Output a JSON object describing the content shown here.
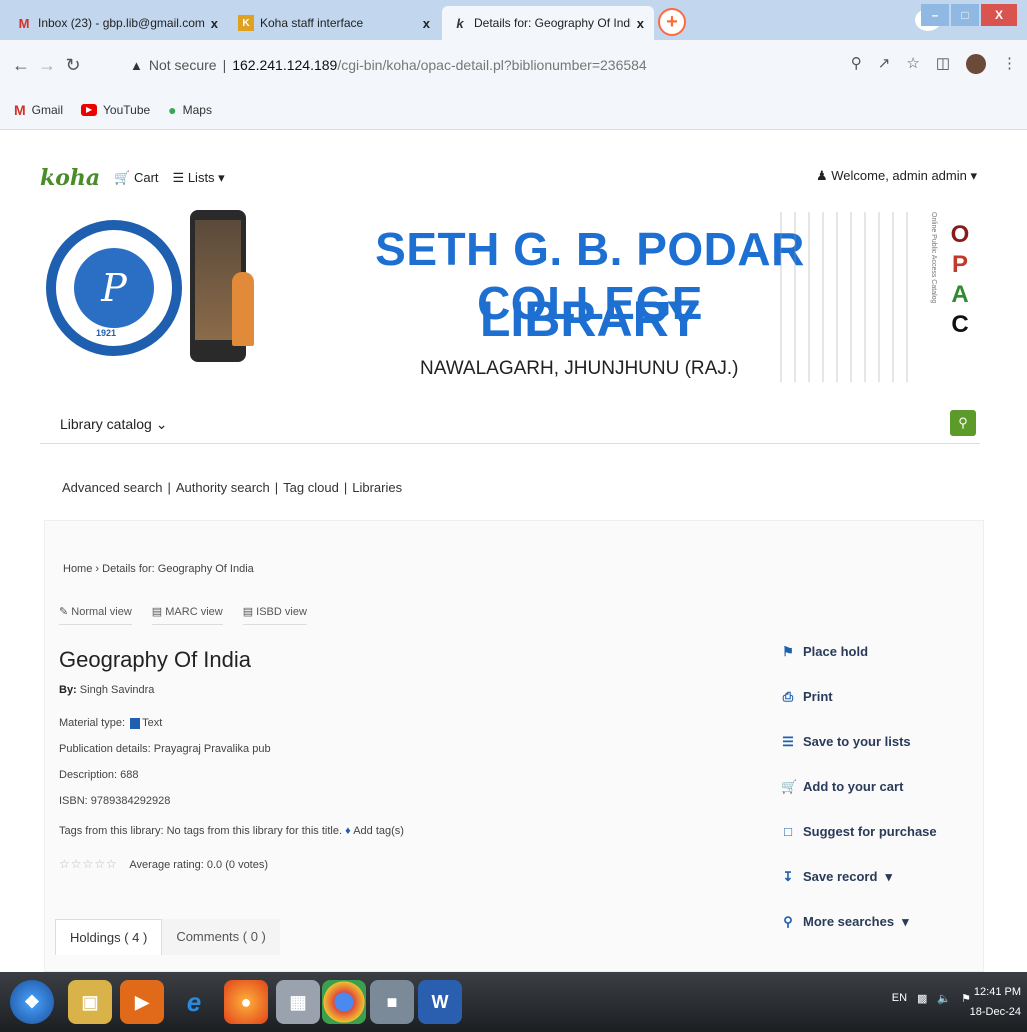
{
  "browser": {
    "tabs": [
      {
        "label": "Inbox (23) - gbp.lib@gmail.com",
        "icon": "gmail-icon"
      },
      {
        "label": "Koha staff interface",
        "icon": "koha-icon"
      },
      {
        "label": "Details for: Geography Of India",
        "icon": "koha-k-icon"
      }
    ],
    "url_security": "Not secure",
    "url_host": "162.241.124.189",
    "url_path": "/cgi-bin/koha/opac-detail.pl?biblionumber=236584",
    "bookmarks": [
      "Gmail",
      "YouTube",
      "Maps"
    ]
  },
  "opac": {
    "logo": "koha",
    "cart_label": "Cart",
    "lists_label": "Lists",
    "welcome": "Welcome, admin admin",
    "banner": {
      "title_line1": "SETH G. B. PODAR COLLEGE",
      "title_line2": "LIBRARY",
      "subtitle": "NAWALAGARH, JHUNJHUNU (RAJ.)",
      "seal_year": "1921",
      "seal_letter": "P",
      "opac_letters": [
        "O",
        "P",
        "A",
        "C"
      ],
      "opac_letter_colors": [
        "#8b1a1a",
        "#c0392b",
        "#2e8b2e",
        "#111111"
      ],
      "vertical_label": "Online Public Access Catalog"
    },
    "search": {
      "catalog_label": "Library catalog"
    },
    "links": [
      "Advanced search",
      "Authority search",
      "Tag cloud",
      "Libraries"
    ],
    "breadcrumb": {
      "home": "Home",
      "current": "Details for: Geography Of India"
    },
    "views": [
      "Normal view",
      "MARC view",
      "ISBD view"
    ],
    "record": {
      "title": "Geography Of India",
      "by_label": "By:",
      "author": "Singh Savindra",
      "material_label": "Material type:",
      "material_value": "Text",
      "publication_label": "Publication details:",
      "publication_value": "Prayagraj Pravalika pub",
      "description_label": "Description:",
      "description_value": "688",
      "isbn_label": "ISBN:",
      "isbn_value": "9789384292928",
      "tags_label": "Tags from this library:",
      "tags_value": "No tags from this library for this title.",
      "add_tags": "Add tag(s)",
      "rating_text": "Average rating: 0.0 (0 votes)",
      "rating_stars": 0
    },
    "bottom_tabs": [
      "Holdings ( 4 )",
      "Comments ( 0 )"
    ],
    "actions": [
      {
        "label": "Place hold",
        "icon": "bookmark-icon"
      },
      {
        "label": "Print",
        "icon": "print-icon"
      },
      {
        "label": "Save to your lists",
        "icon": "list-icon"
      },
      {
        "label": "Add to your cart",
        "icon": "cart-icon"
      },
      {
        "label": "Suggest for purchase",
        "icon": "gift-icon"
      },
      {
        "label": "Save record",
        "icon": "download-icon"
      },
      {
        "label": "More searches",
        "icon": "search-icon"
      }
    ]
  },
  "taskbar": {
    "lang": "EN",
    "time": "12:41 PM",
    "date": "18-Dec-24"
  },
  "colors": {
    "accent_blue": "#1d6fd1",
    "koha_green": "#5c9a2a",
    "tabbar": "#c2d7ee"
  }
}
